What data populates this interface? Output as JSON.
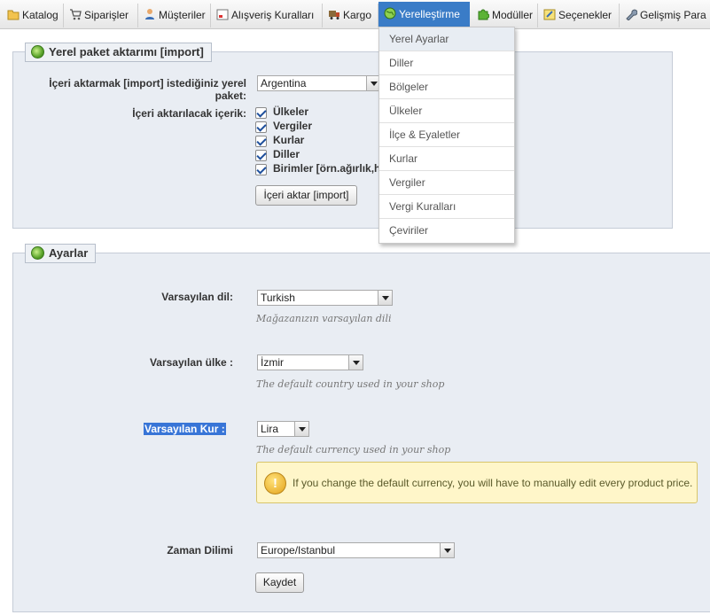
{
  "nav": {
    "tabs": [
      {
        "label": "Katalog",
        "icon": "folder-icon"
      },
      {
        "label": "Siparişler",
        "icon": "cart-icon"
      },
      {
        "label": "Müşteriler",
        "icon": "customers-icon"
      },
      {
        "label": "Alışveriş Kuralları",
        "icon": "rules-icon"
      },
      {
        "label": "Kargo",
        "icon": "truck-icon"
      },
      {
        "label": "Yerelleştirme",
        "icon": "globe-icon"
      },
      {
        "label": "Modüller",
        "icon": "puzzle-icon"
      },
      {
        "label": "Seçenekler",
        "icon": "preferences-icon"
      },
      {
        "label": "Gelişmiş Para",
        "icon": "wrench-icon"
      }
    ],
    "active_tab": "Yerelleştirme"
  },
  "dropdown_menu": {
    "items": [
      "Yerel Ayarlar",
      "Diller",
      "Bölgeler",
      "Ülkeler",
      "İlçe & Eyaletler",
      "Kurlar",
      "Vergiler",
      "Vergi Kuralları",
      "Çeviriler"
    ],
    "selected": "Yerel Ayarlar"
  },
  "import_panel": {
    "legend": "Yerel paket aktarımı [import]",
    "package_label": "İçeri aktarmak [import] istediğiniz yerel paket:",
    "package_value": "Argentina",
    "content_label": "İçeri aktarılacak içerik:",
    "content_items": [
      {
        "label": "Ülkeler",
        "checked": true
      },
      {
        "label": "Vergiler",
        "checked": true
      },
      {
        "label": "Kurlar",
        "checked": true
      },
      {
        "label": "Diller",
        "checked": true
      },
      {
        "label": "Birimler [örn.ağırlık,h",
        "checked": true
      }
    ],
    "import_button": "İçeri aktar [import]"
  },
  "settings_panel": {
    "legend": "Ayarlar",
    "default_language": {
      "label": "Varsayılan dil:",
      "value": "Turkish",
      "hint": "Mağazanızın varsayılan dili"
    },
    "default_country": {
      "label": "Varsayılan ülke :",
      "value": "İzmir",
      "hint": "The default country used in your shop"
    },
    "default_currency": {
      "label": "Varsayılan Kur :",
      "value": "Lira",
      "hint": "The default currency used in your shop"
    },
    "warning": "If you change the default currency, you will have to manually edit every product price.",
    "timezone": {
      "label": "Zaman Dilimi",
      "value": "Europe/Istanbul"
    },
    "save_button": "Kaydet"
  },
  "colors": {
    "active_tab": "#3a7cc7",
    "panel_bg": "#e9edf3",
    "highlight": "#3875d7",
    "warning_bg": "#fff6c9"
  }
}
